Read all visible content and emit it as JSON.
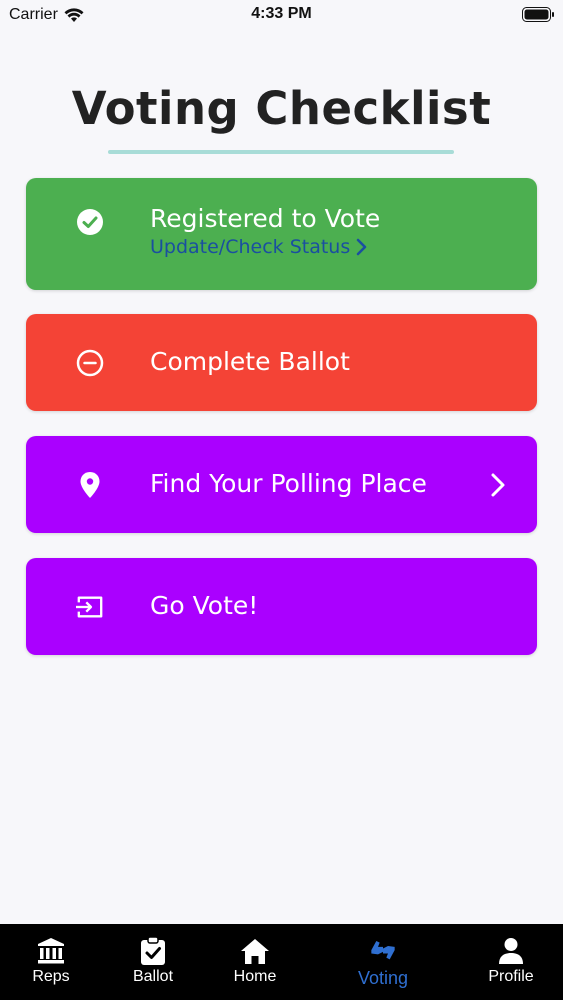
{
  "status_bar": {
    "carrier": "Carrier",
    "time": "4:33 PM"
  },
  "page": {
    "title": "Voting Checklist"
  },
  "cards": [
    {
      "label": "Registered to Vote",
      "sublink": "Update/Check Status",
      "color": "#4caf50",
      "icon": "check-circle-icon"
    },
    {
      "label": "Complete Ballot",
      "color": "#f44336",
      "icon": "minus-circle-icon"
    },
    {
      "label": "Find Your Polling Place",
      "color": "#aa00ff",
      "icon": "location-pin-icon"
    },
    {
      "label": "Go Vote!",
      "color": "#aa00ff",
      "icon": "sign-in-icon"
    }
  ],
  "tabs": [
    {
      "label": "Reps",
      "icon": "institution-icon",
      "active": false
    },
    {
      "label": "Ballot",
      "icon": "clipboard-check-icon",
      "active": false
    },
    {
      "label": "Home",
      "icon": "home-icon",
      "active": false
    },
    {
      "label": "Voting",
      "icon": "voting-hands-icon",
      "active": true
    },
    {
      "label": "Profile",
      "icon": "person-icon",
      "active": false
    }
  ],
  "colors": {
    "accent_underline": "#a8dcd7",
    "active_tab": "#2f6fd1",
    "link": "#1a4fa0"
  }
}
